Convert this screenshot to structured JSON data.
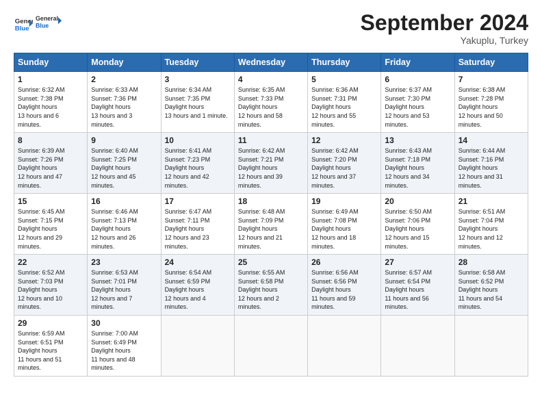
{
  "logo": {
    "line1": "General",
    "line2": "Blue"
  },
  "title": "September 2024",
  "subtitle": "Yakuplu, Turkey",
  "days_header": [
    "Sunday",
    "Monday",
    "Tuesday",
    "Wednesday",
    "Thursday",
    "Friday",
    "Saturday"
  ],
  "weeks": [
    [
      {
        "day": "1",
        "sunrise": "6:32 AM",
        "sunset": "7:38 PM",
        "daylight": "13 hours and 6 minutes."
      },
      {
        "day": "2",
        "sunrise": "6:33 AM",
        "sunset": "7:36 PM",
        "daylight": "13 hours and 3 minutes."
      },
      {
        "day": "3",
        "sunrise": "6:34 AM",
        "sunset": "7:35 PM",
        "daylight": "13 hours and 1 minute."
      },
      {
        "day": "4",
        "sunrise": "6:35 AM",
        "sunset": "7:33 PM",
        "daylight": "12 hours and 58 minutes."
      },
      {
        "day": "5",
        "sunrise": "6:36 AM",
        "sunset": "7:31 PM",
        "daylight": "12 hours and 55 minutes."
      },
      {
        "day": "6",
        "sunrise": "6:37 AM",
        "sunset": "7:30 PM",
        "daylight": "12 hours and 53 minutes."
      },
      {
        "day": "7",
        "sunrise": "6:38 AM",
        "sunset": "7:28 PM",
        "daylight": "12 hours and 50 minutes."
      }
    ],
    [
      {
        "day": "8",
        "sunrise": "6:39 AM",
        "sunset": "7:26 PM",
        "daylight": "12 hours and 47 minutes."
      },
      {
        "day": "9",
        "sunrise": "6:40 AM",
        "sunset": "7:25 PM",
        "daylight": "12 hours and 45 minutes."
      },
      {
        "day": "10",
        "sunrise": "6:41 AM",
        "sunset": "7:23 PM",
        "daylight": "12 hours and 42 minutes."
      },
      {
        "day": "11",
        "sunrise": "6:42 AM",
        "sunset": "7:21 PM",
        "daylight": "12 hours and 39 minutes."
      },
      {
        "day": "12",
        "sunrise": "6:42 AM",
        "sunset": "7:20 PM",
        "daylight": "12 hours and 37 minutes."
      },
      {
        "day": "13",
        "sunrise": "6:43 AM",
        "sunset": "7:18 PM",
        "daylight": "12 hours and 34 minutes."
      },
      {
        "day": "14",
        "sunrise": "6:44 AM",
        "sunset": "7:16 PM",
        "daylight": "12 hours and 31 minutes."
      }
    ],
    [
      {
        "day": "15",
        "sunrise": "6:45 AM",
        "sunset": "7:15 PM",
        "daylight": "12 hours and 29 minutes."
      },
      {
        "day": "16",
        "sunrise": "6:46 AM",
        "sunset": "7:13 PM",
        "daylight": "12 hours and 26 minutes."
      },
      {
        "day": "17",
        "sunrise": "6:47 AM",
        "sunset": "7:11 PM",
        "daylight": "12 hours and 23 minutes."
      },
      {
        "day": "18",
        "sunrise": "6:48 AM",
        "sunset": "7:09 PM",
        "daylight": "12 hours and 21 minutes."
      },
      {
        "day": "19",
        "sunrise": "6:49 AM",
        "sunset": "7:08 PM",
        "daylight": "12 hours and 18 minutes."
      },
      {
        "day": "20",
        "sunrise": "6:50 AM",
        "sunset": "7:06 PM",
        "daylight": "12 hours and 15 minutes."
      },
      {
        "day": "21",
        "sunrise": "6:51 AM",
        "sunset": "7:04 PM",
        "daylight": "12 hours and 12 minutes."
      }
    ],
    [
      {
        "day": "22",
        "sunrise": "6:52 AM",
        "sunset": "7:03 PM",
        "daylight": "12 hours and 10 minutes."
      },
      {
        "day": "23",
        "sunrise": "6:53 AM",
        "sunset": "7:01 PM",
        "daylight": "12 hours and 7 minutes."
      },
      {
        "day": "24",
        "sunrise": "6:54 AM",
        "sunset": "6:59 PM",
        "daylight": "12 hours and 4 minutes."
      },
      {
        "day": "25",
        "sunrise": "6:55 AM",
        "sunset": "6:58 PM",
        "daylight": "12 hours and 2 minutes."
      },
      {
        "day": "26",
        "sunrise": "6:56 AM",
        "sunset": "6:56 PM",
        "daylight": "11 hours and 59 minutes."
      },
      {
        "day": "27",
        "sunrise": "6:57 AM",
        "sunset": "6:54 PM",
        "daylight": "11 hours and 56 minutes."
      },
      {
        "day": "28",
        "sunrise": "6:58 AM",
        "sunset": "6:52 PM",
        "daylight": "11 hours and 54 minutes."
      }
    ],
    [
      {
        "day": "29",
        "sunrise": "6:59 AM",
        "sunset": "6:51 PM",
        "daylight": "11 hours and 51 minutes."
      },
      {
        "day": "30",
        "sunrise": "7:00 AM",
        "sunset": "6:49 PM",
        "daylight": "11 hours and 48 minutes."
      },
      null,
      null,
      null,
      null,
      null
    ]
  ]
}
